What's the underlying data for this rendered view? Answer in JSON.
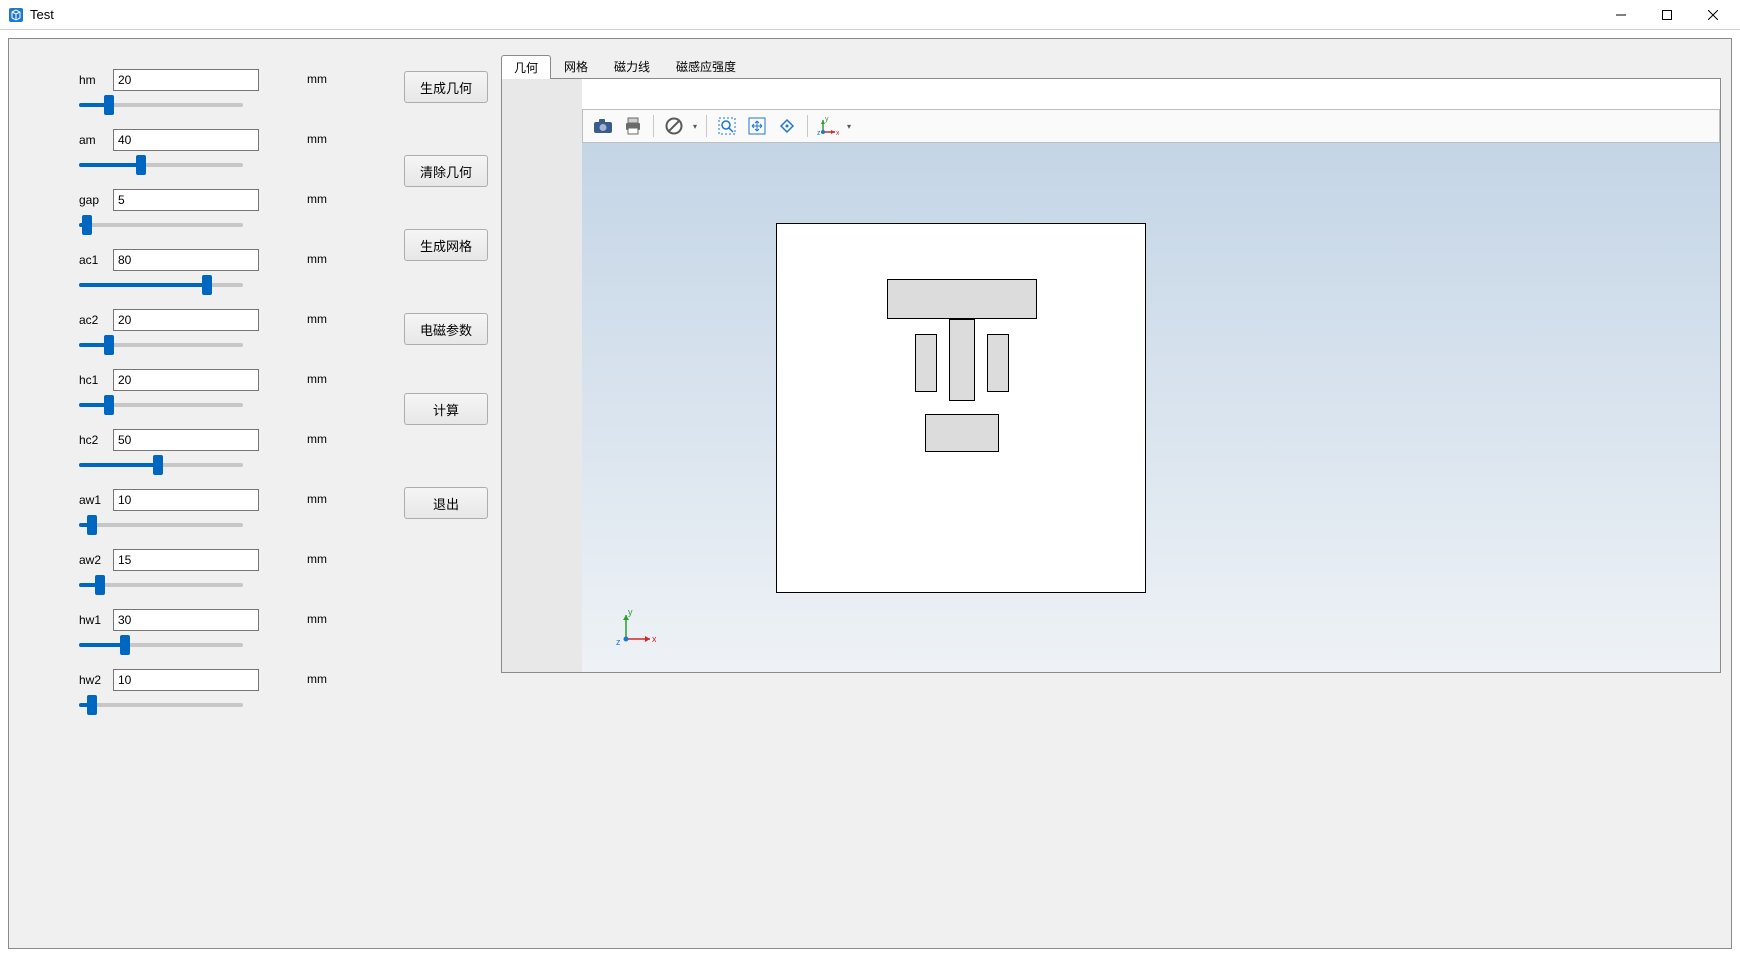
{
  "window": {
    "title": "Test"
  },
  "params": [
    {
      "label": "hm",
      "value": "20",
      "unit": "mm",
      "fill": 18
    },
    {
      "label": "am",
      "value": "40",
      "unit": "mm",
      "fill": 38
    },
    {
      "label": "gap",
      "value": "5",
      "unit": "mm",
      "fill": 5
    },
    {
      "label": "ac1",
      "value": "80",
      "unit": "mm",
      "fill": 78
    },
    {
      "label": "ac2",
      "value": "20",
      "unit": "mm",
      "fill": 18
    },
    {
      "label": "hc1",
      "value": "20",
      "unit": "mm",
      "fill": 18
    },
    {
      "label": "hc2",
      "value": "50",
      "unit": "mm",
      "fill": 48
    },
    {
      "label": "aw1",
      "value": "10",
      "unit": "mm",
      "fill": 8
    },
    {
      "label": "aw2",
      "value": "15",
      "unit": "mm",
      "fill": 13
    },
    {
      "label": "hw1",
      "value": "30",
      "unit": "mm",
      "fill": 28
    },
    {
      "label": "hw2",
      "value": "10",
      "unit": "mm",
      "fill": 8
    }
  ],
  "buttons": {
    "gen_geom": "生成几何",
    "clear_geom": "清除几何",
    "gen_mesh": "生成网格",
    "em_params": "电磁参数",
    "compute": "计算",
    "exit": "退出"
  },
  "button_gaps": [
    52,
    42,
    52,
    48,
    62,
    0
  ],
  "tabs": [
    "几何",
    "网格",
    "磁力线",
    "磁感应强度"
  ],
  "active_tab": 0,
  "toolbar_icons": [
    "camera-icon",
    "print-icon",
    "sep",
    "forbid-icon",
    "dd",
    "sep",
    "zoom-box-icon",
    "zoom-fit-icon",
    "rotate-icon",
    "sep",
    "axis-triad-icon",
    "dd"
  ],
  "axis_labels": {
    "x": "x",
    "y": "y",
    "z": "z"
  }
}
